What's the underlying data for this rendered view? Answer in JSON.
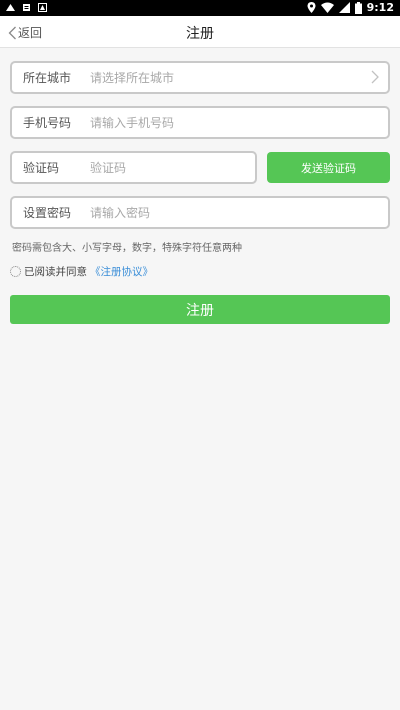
{
  "status_bar": {
    "time": "9:12",
    "icons": [
      "notification-icon",
      "sim-icon",
      "download-icon",
      "location-icon",
      "wifi-icon",
      "signal-icon",
      "battery-icon"
    ]
  },
  "header": {
    "back_label": "返回",
    "title": "注册"
  },
  "form": {
    "city": {
      "label": "所在城市",
      "placeholder": "请选择所在城市"
    },
    "phone": {
      "label": "手机号码",
      "placeholder": "请输入手机号码"
    },
    "code": {
      "label": "验证码",
      "placeholder": "验证码",
      "send_label": "发送验证码"
    },
    "password": {
      "label": "设置密码",
      "placeholder": "请输入密码"
    },
    "password_hint": "密码需包含大、小写字母，数字，特殊字符任意两种",
    "agreement_text": "已阅读并同意",
    "agreement_link": "《注册协议》",
    "submit_label": "注册"
  },
  "colors": {
    "accent": "#55c655",
    "link": "#3a8ed8",
    "border": "#c9c9c9"
  }
}
